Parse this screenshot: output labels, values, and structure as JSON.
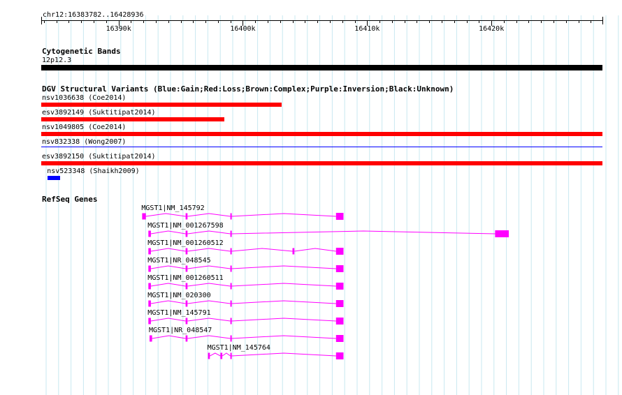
{
  "colors": {
    "grid": "#c8e8f0",
    "gain": "#0000ff",
    "loss": "#ff0000",
    "cytoband": "#000000",
    "gene": "#ff00ff"
  },
  "ruler": {
    "region": "chr12:16383782..16428936",
    "start": 16383782,
    "end": 16428936,
    "ticks": [
      {
        "pos": 16390000,
        "label": "16390k"
      },
      {
        "pos": 16400000,
        "label": "16400k"
      },
      {
        "pos": 16410000,
        "label": "16410k"
      },
      {
        "pos": 16420000,
        "label": "16420k"
      }
    ]
  },
  "tracks": {
    "cytoband": {
      "title": "Cytogenetic Bands",
      "band_label": "12p12.3"
    },
    "dgv": {
      "title": "DGV Structural Variants (Blue:Gain;Red:Loss;Brown:Complex;Purple:Inversion;Black:Unknown)",
      "variants": [
        {
          "label": "nsv1036638 (Coe2014)",
          "type": "loss",
          "start": 16383782,
          "end": 16403100
        },
        {
          "label": "esv3892149 (Suktitipat2014)",
          "type": "loss",
          "start": 16383782,
          "end": 16398500
        },
        {
          "label": "nsv1049805 (Coe2014)",
          "type": "loss",
          "start": 16383782,
          "end": 16428936
        },
        {
          "label": "nsv832338 (Wong2007)",
          "type": "gain",
          "start": 16383782,
          "end": 16428936
        },
        {
          "label": "esv3892150 (Suktitipat2014)",
          "type": "loss",
          "start": 16383782,
          "end": 16428936
        },
        {
          "label": "nsv523348 (Shaikh2009)",
          "type": "gain",
          "start": 16384300,
          "end": 16385300
        }
      ]
    },
    "refseq": {
      "title": "RefSeq Genes",
      "genes": [
        {
          "label": "MGST1|NM_145792",
          "exons": [
            [
              16391900,
              16392200
            ],
            [
              16395400,
              16395550
            ],
            [
              16399000,
              16399100
            ],
            [
              16407500,
              16408100
            ]
          ]
        },
        {
          "label": "MGST1|NM_001267598",
          "exons": [
            [
              16392400,
              16392600
            ],
            [
              16395400,
              16395550
            ],
            [
              16399000,
              16399100
            ],
            [
              16420300,
              16421400
            ]
          ]
        },
        {
          "label": "MGST1|NM_001260512",
          "exons": [
            [
              16392400,
              16392600
            ],
            [
              16395400,
              16395550
            ],
            [
              16399000,
              16399100
            ],
            [
              16404000,
              16404150
            ],
            [
              16407500,
              16408100
            ]
          ]
        },
        {
          "label": "MGST1|NR_048545",
          "exons": [
            [
              16392400,
              16392600
            ],
            [
              16395400,
              16395550
            ],
            [
              16399000,
              16399100
            ],
            [
              16407500,
              16408100
            ]
          ]
        },
        {
          "label": "MGST1|NM_001260511",
          "exons": [
            [
              16392400,
              16392600
            ],
            [
              16395400,
              16395550
            ],
            [
              16399000,
              16399100
            ],
            [
              16407500,
              16408100
            ]
          ]
        },
        {
          "label": "MGST1|NM_020300",
          "exons": [
            [
              16392400,
              16392600
            ],
            [
              16395400,
              16395550
            ],
            [
              16399000,
              16399100
            ],
            [
              16407500,
              16408100
            ]
          ]
        },
        {
          "label": "MGST1|NM_145791",
          "exons": [
            [
              16392400,
              16392600
            ],
            [
              16395400,
              16395550
            ],
            [
              16399000,
              16399100
            ],
            [
              16407500,
              16408100
            ]
          ]
        },
        {
          "label": "MGST1|NR_048547",
          "exons": [
            [
              16392500,
              16392700
            ],
            [
              16395400,
              16395550
            ],
            [
              16399000,
              16399100
            ],
            [
              16407500,
              16408100
            ]
          ]
        },
        {
          "label": "MGST1|NM_145764",
          "exons": [
            [
              16397200,
              16397350
            ],
            [
              16398200,
              16398350
            ],
            [
              16399000,
              16399100
            ],
            [
              16407500,
              16408100
            ]
          ]
        }
      ]
    }
  }
}
